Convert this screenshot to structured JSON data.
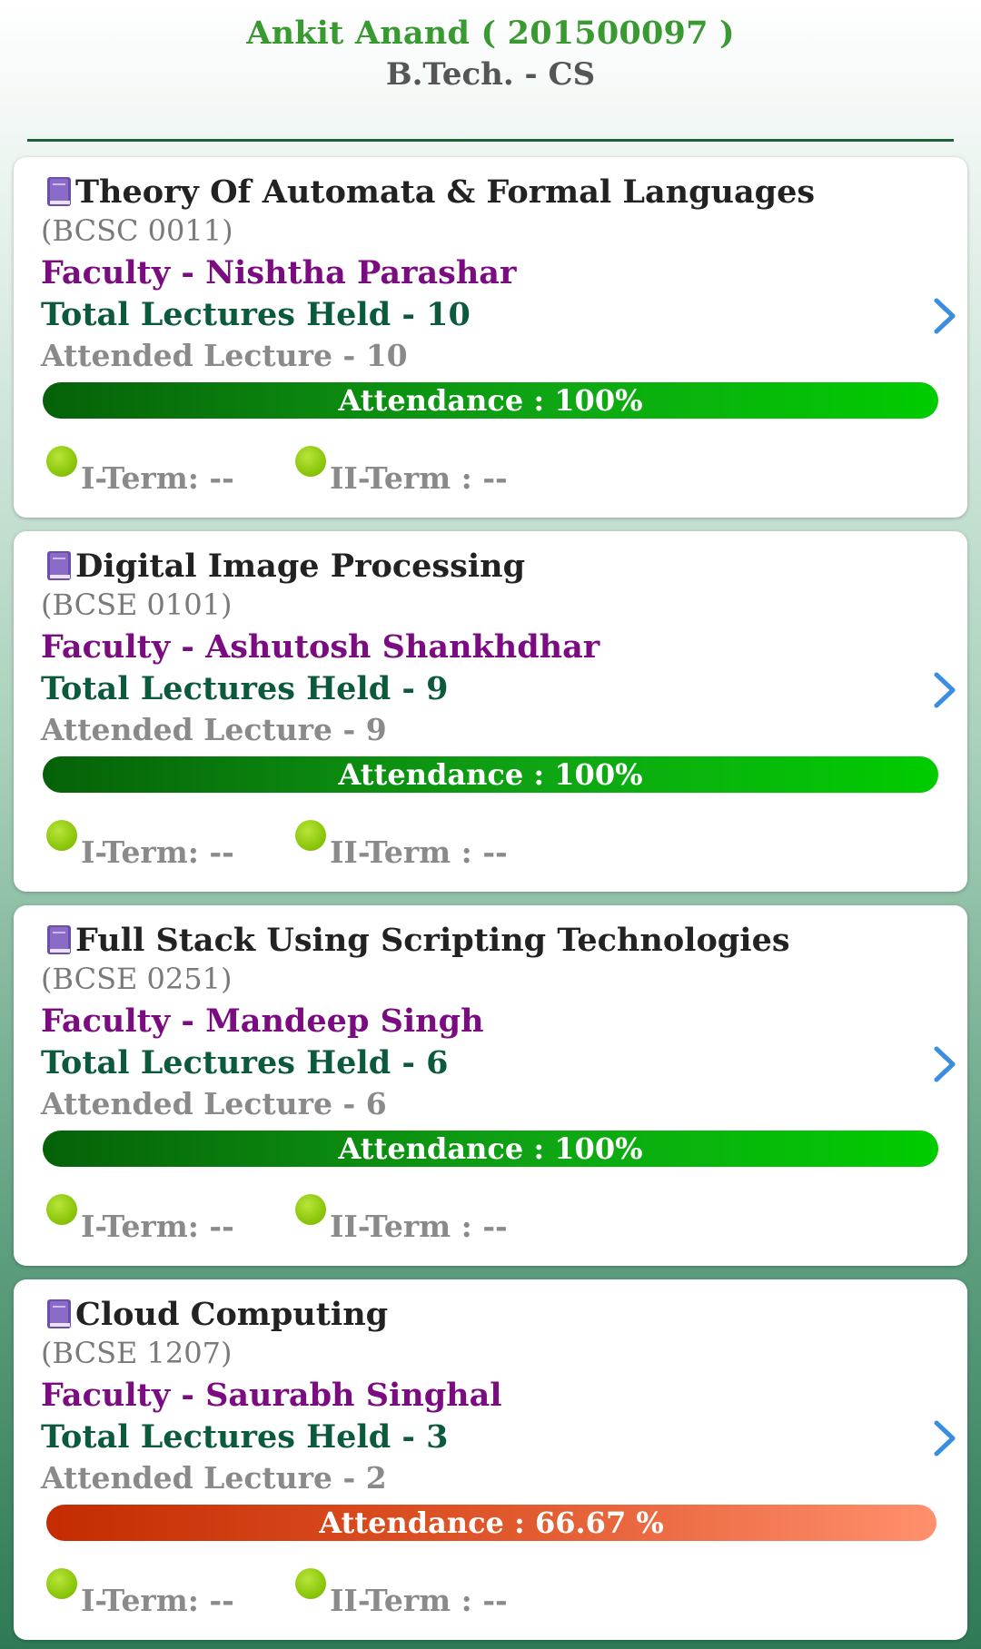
{
  "header": {
    "student": "Ankit Anand  ( 201500097 )",
    "program": "B.Tech. - CS"
  },
  "colors": {
    "header_name": "#3a9a32",
    "faculty": "#7b0b80",
    "total": "#0b5a3b",
    "bar_full": "#0fa414",
    "bar_low": "#e0562a",
    "term_dot": "#8cc70c",
    "chevron": "#3a8ee0"
  },
  "icons": {
    "subject": "book-icon",
    "navigate": "chevron-right-icon",
    "term": "green-dot-icon"
  },
  "courses": [
    {
      "title": "Theory Of Automata & Formal Languages",
      "code": "(BCSC 0011)",
      "faculty": "Faculty  - Nishtha Parashar",
      "total": "Total Lectures Held - 10",
      "attended": "Attended Lecture - 10",
      "attendance": "Attendance : 100%",
      "attendance_percent": 100,
      "term1": "I-Term: --",
      "term2": "II-Term : --"
    },
    {
      "title": "Digital Image Processing",
      "code": "(BCSE 0101)",
      "faculty": "Faculty  - Ashutosh Shankhdhar",
      "total": "Total Lectures Held - 9",
      "attended": "Attended Lecture - 9",
      "attendance": "Attendance : 100%",
      "attendance_percent": 100,
      "term1": "I-Term: --",
      "term2": "II-Term : --"
    },
    {
      "title": "Full Stack Using Scripting Technologies",
      "code": "(BCSE 0251)",
      "faculty": "Faculty  - Mandeep Singh",
      "total": "Total Lectures Held - 6",
      "attended": "Attended Lecture - 6",
      "attendance": "Attendance : 100%",
      "attendance_percent": 100,
      "term1": "I-Term: --",
      "term2": "II-Term : --"
    },
    {
      "title": "Cloud Computing",
      "code": "(BCSE 1207)",
      "faculty": "Faculty  - Saurabh Singhal",
      "total": "Total Lectures Held - 3",
      "attended": "Attended Lecture - 2",
      "attendance": "Attendance : 66.67  %",
      "attendance_percent": 66.67,
      "term1": "I-Term: --",
      "term2": "II-Term : --"
    }
  ]
}
